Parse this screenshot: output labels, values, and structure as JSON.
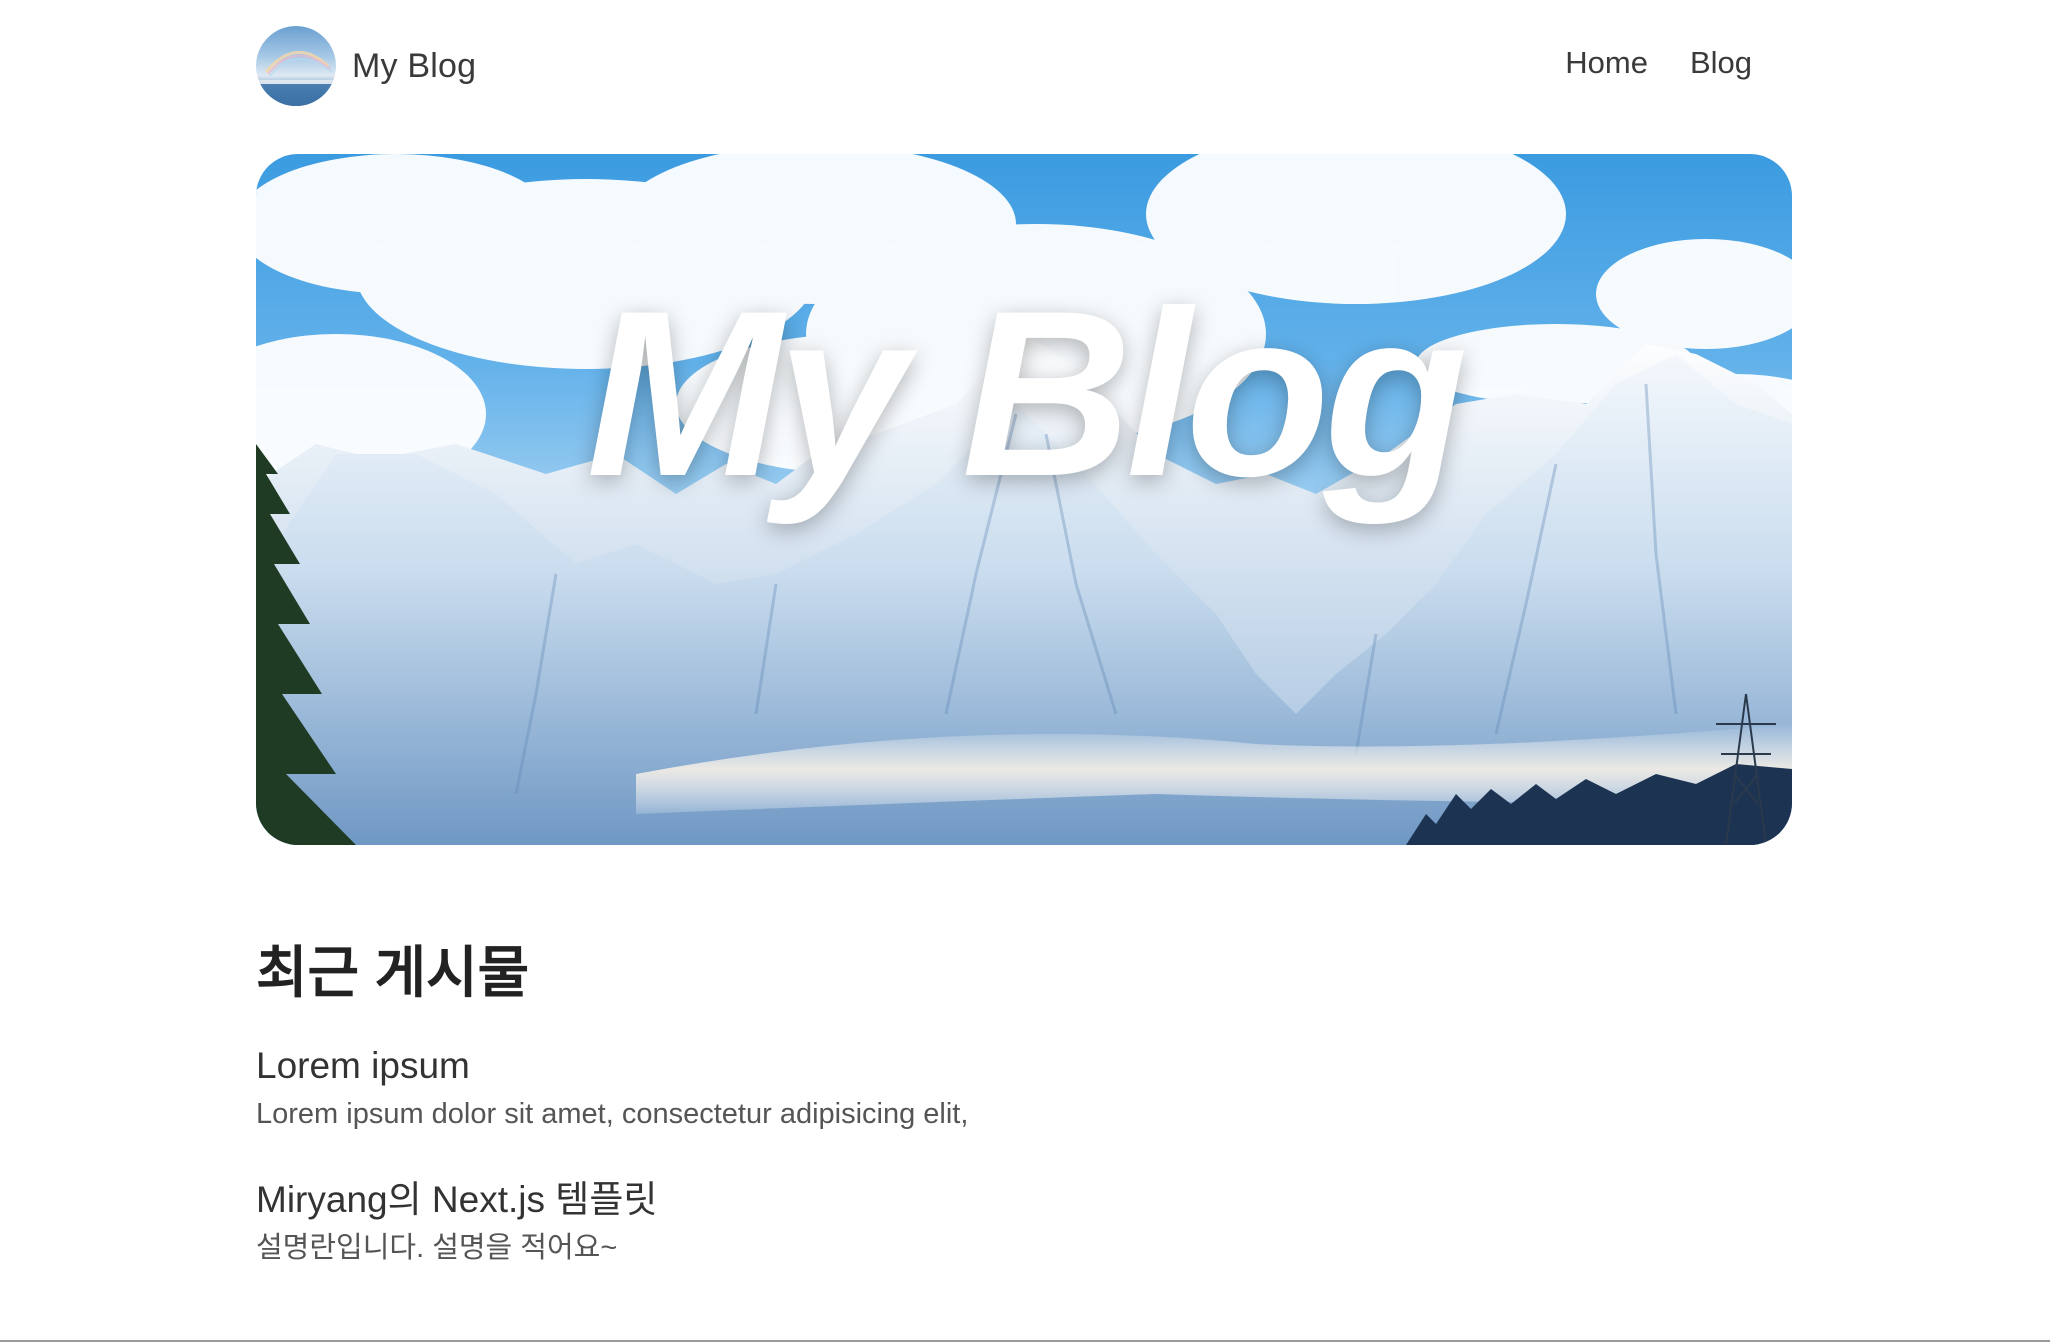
{
  "header": {
    "brand": "My Blog",
    "avatar_icon": "rainbow-lake-avatar",
    "nav": [
      {
        "label": "Home"
      },
      {
        "label": "Blog"
      }
    ]
  },
  "hero": {
    "title": "My Blog",
    "image": "snowy-mountain-range-photo"
  },
  "recent": {
    "heading": "최근 게시물",
    "posts": [
      {
        "title": "Lorem ipsum",
        "description": "Lorem ipsum dolor sit amet, consectetur adipisicing elit,"
      },
      {
        "title": "Miryang의 Next.js 템플릿",
        "description": "설명란입니다. 설명을 적어요~"
      }
    ]
  },
  "colors": {
    "text": "#222222",
    "sky": "#3b9be0",
    "background": "#ffffff"
  }
}
